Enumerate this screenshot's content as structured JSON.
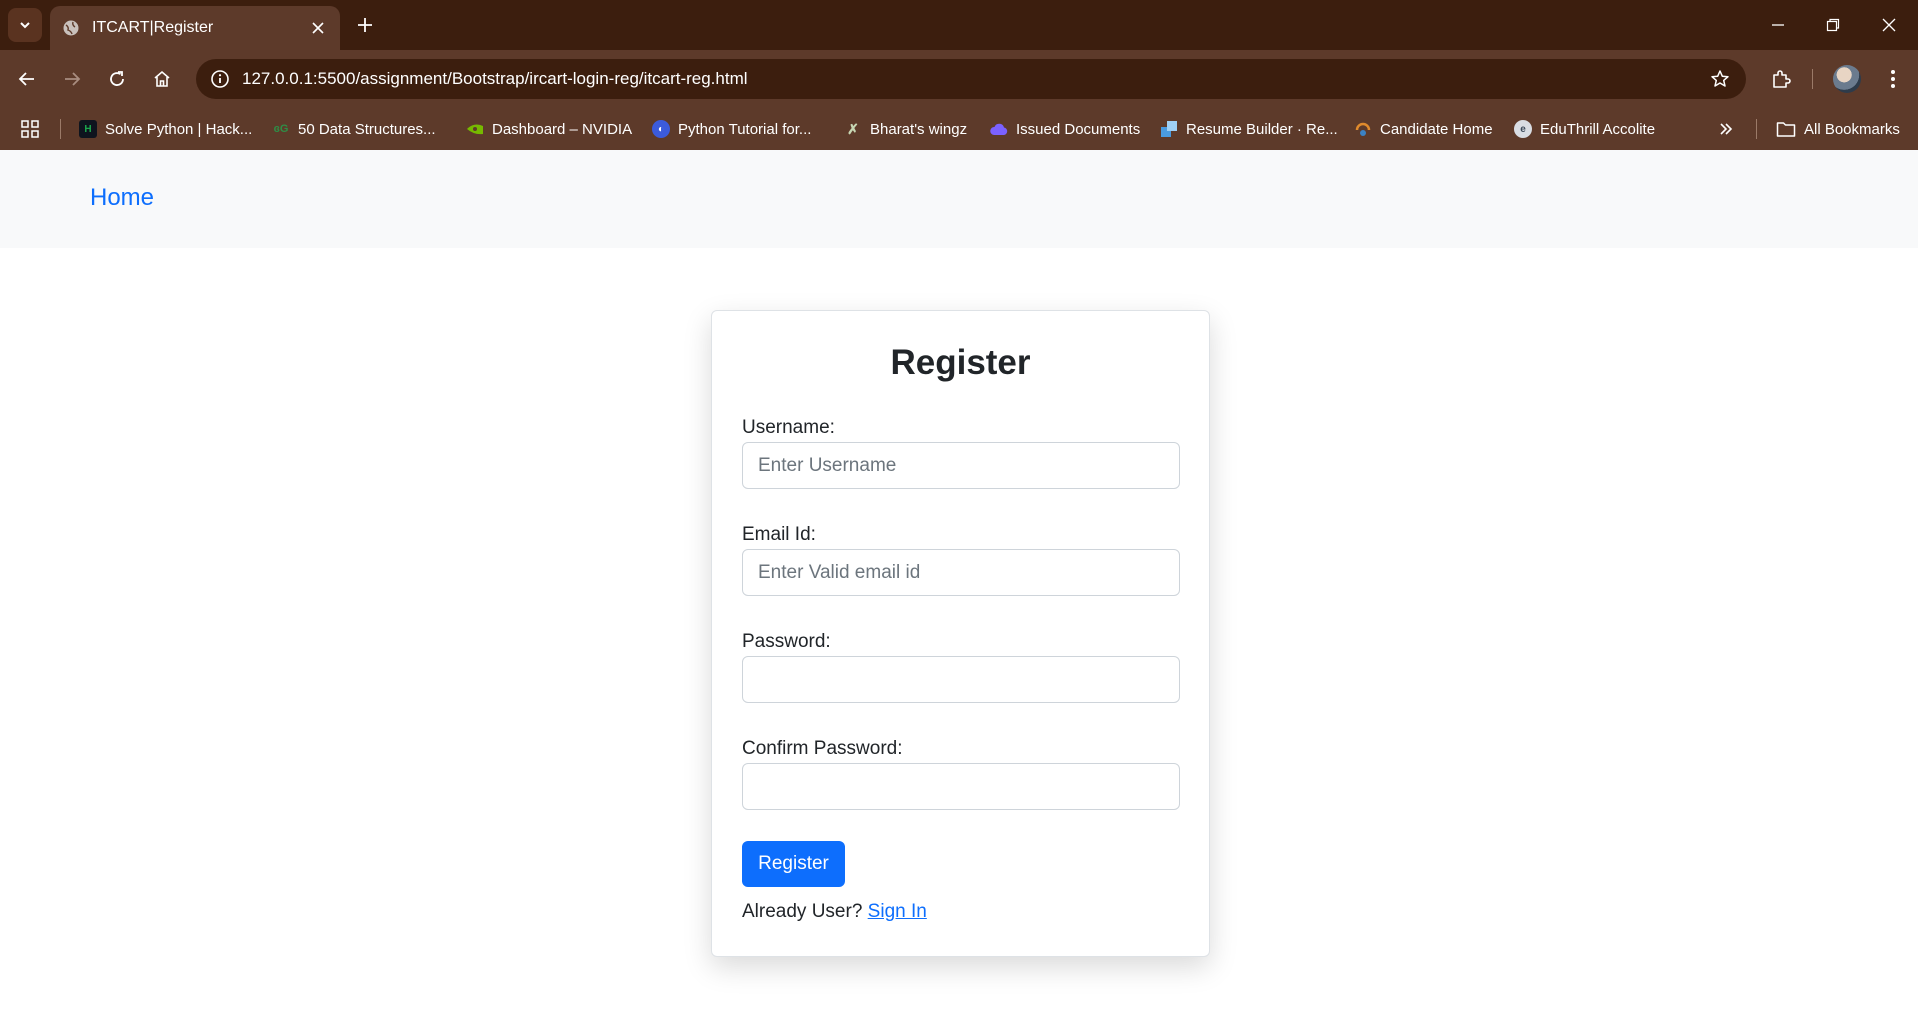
{
  "browser": {
    "tab_title": "ITCART|Register",
    "url": "127.0.0.1:5500/assignment/Bootstrap/ircart-login-reg/itcart-reg.html",
    "bookmarks": [
      {
        "label": "Solve Python | Hack...",
        "icon": "hackerrank-icon",
        "color": "#1ba94c"
      },
      {
        "label": "50 Data Structures...",
        "icon": "geeksforgeeks-icon",
        "color": "#2f8d46"
      },
      {
        "label": "Dashboard – NVIDIA",
        "icon": "nvidia-icon",
        "color": "#76b900"
      },
      {
        "label": "Python Tutorial for...",
        "icon": "python-icon",
        "color": "#3b5bdb"
      },
      {
        "label": "Bharat's wingz",
        "icon": "wingz-icon",
        "color": "#7c8b6a"
      },
      {
        "label": "Issued Documents",
        "icon": "cloud-icon",
        "color": "#7b61ff"
      },
      {
        "label": "Resume Builder · Re...",
        "icon": "resume-icon",
        "color": "#4a9be0"
      },
      {
        "label": "Candidate Home",
        "icon": "candidate-icon",
        "color": "#e08a2c"
      },
      {
        "label": "EduThrill Accolite",
        "icon": "eduthrill-icon",
        "color": "#d9dde3"
      }
    ],
    "all_bookmarks": "All Bookmarks"
  },
  "navbar": {
    "home": "Home"
  },
  "form": {
    "title": "Register",
    "username_label": "Username:",
    "username_placeholder": "Enter Username",
    "email_label": "Email Id:",
    "email_placeholder": "Enter Valid email id",
    "password_label": "Password:",
    "confirm_label": "Confirm Password:",
    "submit": "Register",
    "already_text": "Already User?",
    "signin_link": "Sign In"
  },
  "colors": {
    "primary": "#0d6efd",
    "chrome": "#5d3a2a",
    "tabstrip": "#3c1e0e",
    "navbar": "#f8f9fa"
  }
}
